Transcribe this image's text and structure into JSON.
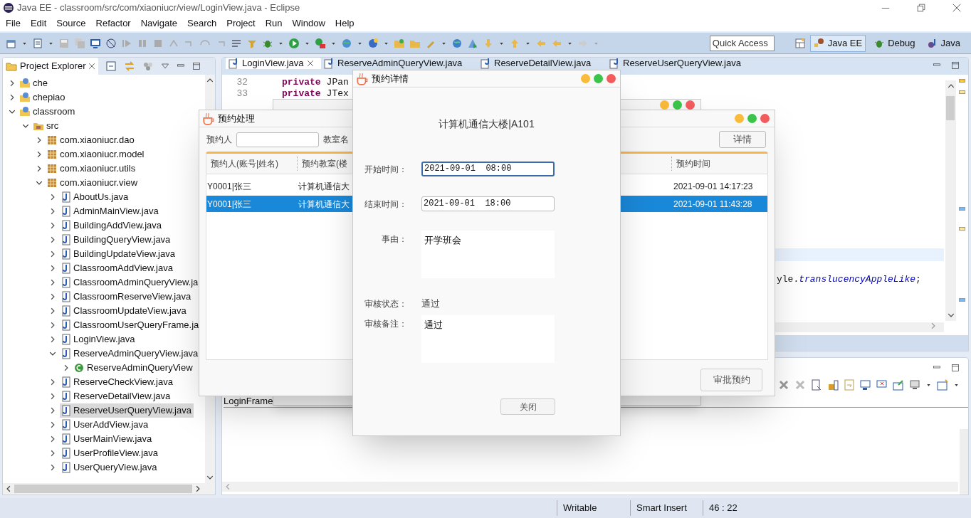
{
  "window": {
    "title": "Java EE - classroom/src/com/xiaoniucr/view/LoginView.java - Eclipse"
  },
  "menu": [
    "File",
    "Edit",
    "Source",
    "Refactor",
    "Navigate",
    "Search",
    "Project",
    "Run",
    "Window",
    "Help"
  ],
  "quick_access": {
    "placeholder": "Quick Access"
  },
  "perspectives": [
    {
      "label": "Java EE",
      "selected": true
    },
    {
      "label": "Debug",
      "selected": false
    },
    {
      "label": "Java",
      "selected": false
    }
  ],
  "project_explorer": {
    "title": "Project Explorer",
    "tree": [
      {
        "kind": "project",
        "label": "che",
        "expanded": false
      },
      {
        "kind": "project",
        "label": "chepiao",
        "expanded": false
      },
      {
        "kind": "project",
        "label": "classroom",
        "expanded": true,
        "children": [
          {
            "kind": "folder",
            "label": "src",
            "expanded": true,
            "children": [
              {
                "kind": "package",
                "label": "com.xiaoniucr.dao",
                "expanded": false
              },
              {
                "kind": "package",
                "label": "com.xiaoniucr.model",
                "expanded": false
              },
              {
                "kind": "package",
                "label": "com.xiaoniucr.utils",
                "expanded": false
              },
              {
                "kind": "package",
                "label": "com.xiaoniucr.view",
                "expanded": true,
                "children": [
                  {
                    "kind": "java",
                    "label": "AboutUs.java",
                    "expanded": false,
                    "selected": false
                  },
                  {
                    "kind": "java",
                    "label": "AdminMainView.java",
                    "expanded": false,
                    "selected": false
                  },
                  {
                    "kind": "java",
                    "label": "BuildingAddView.java",
                    "expanded": false,
                    "selected": false
                  },
                  {
                    "kind": "java",
                    "label": "BuildingQueryView.java",
                    "expanded": false,
                    "selected": false
                  },
                  {
                    "kind": "java",
                    "label": "BuildingUpdateView.java",
                    "expanded": false,
                    "selected": false
                  },
                  {
                    "kind": "java",
                    "label": "ClassroomAddView.java",
                    "expanded": false,
                    "selected": false
                  },
                  {
                    "kind": "java",
                    "label": "ClassroomAdminQueryView.ja",
                    "expanded": false,
                    "selected": false
                  },
                  {
                    "kind": "java",
                    "label": "ClassroomReserveView.java",
                    "expanded": false,
                    "selected": false
                  },
                  {
                    "kind": "java",
                    "label": "ClassroomUpdateView.java",
                    "expanded": false,
                    "selected": false
                  },
                  {
                    "kind": "java",
                    "label": "ClassroomUserQueryFrame.ja",
                    "expanded": false,
                    "selected": false
                  },
                  {
                    "kind": "java",
                    "label": "LoginView.java",
                    "expanded": false,
                    "selected": false
                  },
                  {
                    "kind": "java",
                    "label": "ReserveAdminQueryView.java",
                    "expanded": true,
                    "selected": false,
                    "children": [
                      {
                        "kind": "class",
                        "label": "ReserveAdminQueryView",
                        "expanded": false,
                        "selected": false
                      }
                    ]
                  },
                  {
                    "kind": "java",
                    "label": "ReserveCheckView.java",
                    "expanded": false,
                    "selected": false
                  },
                  {
                    "kind": "java",
                    "label": "ReserveDetailView.java",
                    "expanded": false,
                    "selected": false
                  },
                  {
                    "kind": "java",
                    "label": "ReserveUserQueryView.java",
                    "expanded": false,
                    "selected": true
                  },
                  {
                    "kind": "java",
                    "label": "UserAddView.java",
                    "expanded": false,
                    "selected": false
                  },
                  {
                    "kind": "java",
                    "label": "UserMainView.java",
                    "expanded": false,
                    "selected": false
                  },
                  {
                    "kind": "java",
                    "label": "UserProfileView.java",
                    "expanded": false,
                    "selected": false
                  },
                  {
                    "kind": "java",
                    "label": "UserQueryView.java",
                    "expanded": false,
                    "selected": false
                  }
                ]
              }
            ]
          }
        ]
      }
    ]
  },
  "editor": {
    "tabs": [
      {
        "label": "LoginView.java",
        "selected": true
      },
      {
        "label": "ReserveAdminQueryView.java",
        "selected": false
      },
      {
        "label": "ReserveDetailView.java",
        "selected": false
      },
      {
        "label": "ReserveUserQueryView.java",
        "selected": false
      }
    ],
    "lines": [
      {
        "number": "32",
        "keyword": "private",
        "code": "JPan"
      },
      {
        "number": "33",
        "keyword": "private",
        "code": "JTex"
      }
    ],
    "fragment": {
      "plain": "yle.",
      "field": "translucencyAppleLike",
      "end": ";"
    }
  },
  "console": {
    "launch": "LoginFrame"
  },
  "status_bar": [
    "Writable",
    "Smart Insert",
    "46 : 22"
  ],
  "reserve_dialog": {
    "title": "预约处理",
    "person_label": "预约人",
    "room_label": "教室名",
    "detail_button": "详情",
    "columns": [
      "预约人(账号|姓名)",
      "预约教室(楼",
      "预约时间"
    ],
    "rows": [
      {
        "person": "Y0001|张三",
        "room": "计算机通信大",
        "time": "2021-09-01 14:17:23",
        "selected": false
      },
      {
        "person": "Y0001|张三",
        "room": "计算机通信大",
        "time": "2021-09-01 11:43:28",
        "selected": true
      }
    ],
    "approve_button": "审批预约"
  },
  "detail_dialog": {
    "title": "预约详情",
    "heading": "计算机通信大楼|A101",
    "fields": [
      {
        "kind": "input",
        "label": "开始时间：",
        "value": "2021-09-01  08:00",
        "focused": true
      },
      {
        "kind": "input",
        "label": "结束时间：",
        "value": "2021-09-01  18:00",
        "focused": false
      },
      {
        "kind": "area",
        "label": "事由：",
        "value": "开学班会"
      },
      {
        "kind": "text",
        "label": "审核状态：",
        "value": "通过"
      },
      {
        "kind": "area",
        "label": "审核备注：",
        "value": "通过"
      }
    ],
    "close_button": "关闭"
  }
}
